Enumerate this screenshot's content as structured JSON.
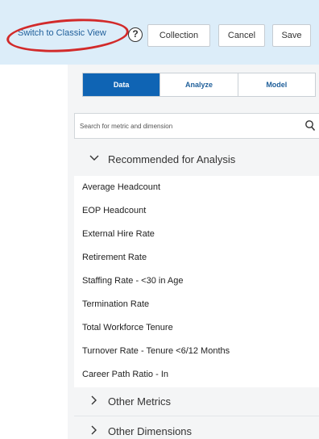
{
  "toolbar": {
    "switch_view_label": "Switch to Classic View",
    "help_icon_glyph": "?",
    "collection_label": "Collection",
    "cancel_label": "Cancel",
    "save_label": "Save"
  },
  "tabs": [
    {
      "label": "Data",
      "active": true
    },
    {
      "label": "Analyze",
      "active": false
    },
    {
      "label": "Model",
      "active": false
    }
  ],
  "search": {
    "placeholder": "Search for metric and dimension",
    "icon": "search-icon"
  },
  "sections": {
    "recommended": {
      "label": "Recommended for Analysis",
      "expanded": true,
      "icon": "chevron-down-icon",
      "items": [
        "Average Headcount",
        "EOP Headcount",
        "External Hire Rate",
        "Retirement Rate",
        "Staffing Rate - <30 in Age",
        "Termination Rate",
        "Total Workforce Tenure",
        "Turnover Rate - Tenure <6/12 Months",
        "Career Path Ratio - In"
      ]
    },
    "other_metrics": {
      "label": "Other Metrics",
      "expanded": false,
      "icon": "chevron-right-icon"
    },
    "other_dimensions": {
      "label": "Other Dimensions",
      "expanded": false,
      "icon": "chevron-right-icon"
    }
  },
  "colors": {
    "toolbar_bg": "#dcedf9",
    "accent": "#0f64b4",
    "highlight_ring": "#d22a2a",
    "link": "#1f5f9a"
  }
}
